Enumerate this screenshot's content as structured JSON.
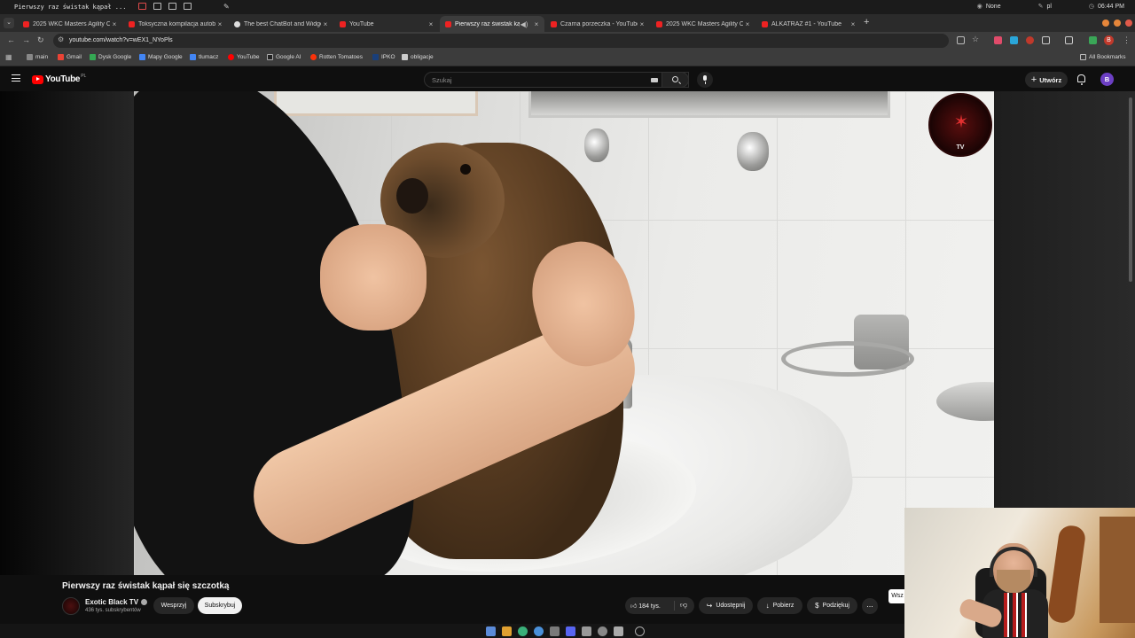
{
  "os": {
    "window_title": "Pierwszy raz świstak kąpał ...",
    "status_user": "None",
    "status_lang": "pl",
    "clock": "06:44 PM"
  },
  "tabs": [
    {
      "label": "2025 WKC Masters Agility C",
      "icon": "youtube-icon"
    },
    {
      "label": "Toksyczna kompilacja autob",
      "icon": "youtube-icon"
    },
    {
      "label": "The best ChatBot and Widge",
      "icon": "chatbot-icon"
    },
    {
      "label": "YouTube",
      "icon": "youtube-icon"
    },
    {
      "label": "Pierwszy raz świstak kąp",
      "icon": "youtube-icon",
      "active": true
    },
    {
      "label": "Czarna porzeczka - YouTube",
      "icon": "youtube-icon"
    },
    {
      "label": "2025 WKC Masters Agility C",
      "icon": "youtube-icon"
    },
    {
      "label": "ALKATRAZ #1 - YouTube",
      "icon": "youtube-icon"
    }
  ],
  "address": {
    "url": "youtube.com/watch?v=wEX1_NYoPls"
  },
  "bookmarks": [
    {
      "label": "main",
      "color": "#888888"
    },
    {
      "label": "Gmail",
      "color": "#ea4335"
    },
    {
      "label": "Dysk Google",
      "color": "#34a853"
    },
    {
      "label": "Mapy Google",
      "color": "#4285f4"
    },
    {
      "label": "tlumacz",
      "color": "#4285f4"
    },
    {
      "label": "YouTube",
      "color": "#ff0000"
    },
    {
      "label": "Google AI",
      "color": "#222222"
    },
    {
      "label": "Rotten Tomatoes",
      "color": "#fa320a"
    },
    {
      "label": "IPKO",
      "color": "#1a3f7a"
    },
    {
      "label": "obligacje",
      "color": "#cccccc"
    }
  ],
  "all_bookmarks": "All Bookmarks",
  "youtube": {
    "logo": "YouTube",
    "region": "PL",
    "search_placeholder": "Szukaj",
    "create_label": "Utwórz",
    "user_initial": "B"
  },
  "video": {
    "title": "Pierwszy raz świstak kąpał się szczotką",
    "channel_name": "Exotic Black TV",
    "channel_subs": "436 tys. subskrybentów",
    "support_label": "Wesprzyj",
    "subscribe_label": "Subskrybuj",
    "likes": "184 tys.",
    "share_label": "Udostępnij",
    "download_label": "Pobierz",
    "thanks_label": "Podziękuj",
    "more_label": "...",
    "badge_text": "TV",
    "side_button": "Wsz"
  },
  "colors": {
    "accent": "#ff0000",
    "background": "#0f0f0f",
    "pill": "#272727"
  }
}
